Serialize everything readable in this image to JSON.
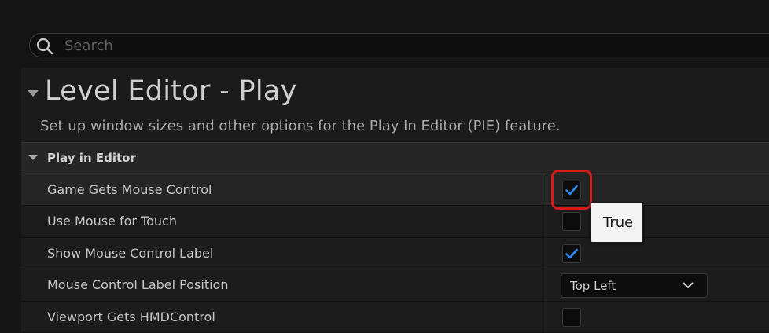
{
  "search": {
    "placeholder": "Search",
    "value": ""
  },
  "section": {
    "title": "Level Editor - Play",
    "description": "Set up window sizes and other options for the Play In Editor (PIE) feature."
  },
  "category": {
    "label": "Play in Editor",
    "expanded": true
  },
  "rows": [
    {
      "label": "Game Gets Mouse Control",
      "type": "checkbox",
      "checked": true
    },
    {
      "label": "Use Mouse for Touch",
      "type": "checkbox",
      "checked": false
    },
    {
      "label": "Show Mouse Control Label",
      "type": "checkbox",
      "checked": true
    },
    {
      "label": "Mouse Control Label Position",
      "type": "dropdown",
      "value": "Top Left"
    },
    {
      "label": "Viewport Gets HMDControl",
      "type": "checkbox",
      "checked": false
    }
  ],
  "tooltip": {
    "text": "True"
  },
  "colors": {
    "checkmark": "#2a8cf0",
    "highlight": "#d61a1a"
  }
}
